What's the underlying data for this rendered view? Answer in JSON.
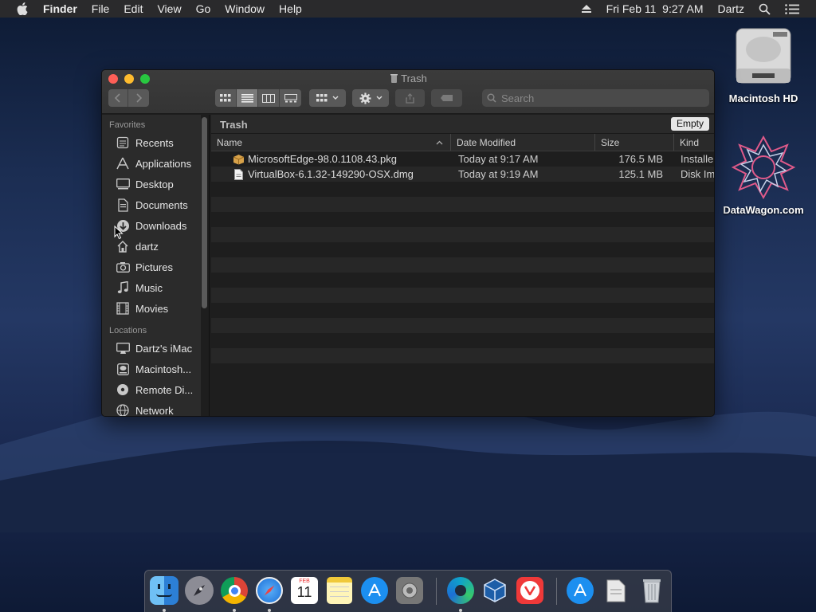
{
  "menubar": {
    "items": [
      {
        "label": "Finder",
        "bold": true
      },
      {
        "label": "File"
      },
      {
        "label": "Edit"
      },
      {
        "label": "View"
      },
      {
        "label": "Go"
      },
      {
        "label": "Window"
      },
      {
        "label": "Help"
      }
    ],
    "datetime": "Fri Feb 11  9:27 AM",
    "user": "Dartz"
  },
  "desktop": {
    "icons": [
      {
        "label": "Macintosh HD",
        "icon": "hard-drive-icon"
      },
      {
        "label": "DataWagon.com",
        "icon": "datawagon-logo-icon"
      }
    ]
  },
  "window": {
    "title": "Trash",
    "search_placeholder": "Search",
    "path_title": "Trash",
    "empty_label": "Empty",
    "sidebar": {
      "favorites_header": "Favorites",
      "favorites": [
        {
          "label": "Recents",
          "icon": "recents-icon"
        },
        {
          "label": "Applications",
          "icon": "applications-icon"
        },
        {
          "label": "Desktop",
          "icon": "desktop-icon"
        },
        {
          "label": "Documents",
          "icon": "documents-icon"
        },
        {
          "label": "Downloads",
          "icon": "downloads-icon"
        },
        {
          "label": "dartz",
          "icon": "home-icon"
        },
        {
          "label": "Pictures",
          "icon": "camera-icon"
        },
        {
          "label": "Music",
          "icon": "music-note-icon"
        },
        {
          "label": "Movies",
          "icon": "film-icon"
        }
      ],
      "locations_header": "Locations",
      "locations": [
        {
          "label": "Dartz's iMac",
          "icon": "imac-icon"
        },
        {
          "label": "Macintosh...",
          "icon": "disk-icon"
        },
        {
          "label": "Remote Di...",
          "icon": "remote-disc-icon"
        },
        {
          "label": "Network",
          "icon": "network-icon"
        }
      ]
    },
    "columns": [
      "Name",
      "Date Modified",
      "Size",
      "Kind"
    ],
    "files": [
      {
        "name": "MicrosoftEdge-98.0.1108.43.pkg",
        "modified": "Today at 9:17 AM",
        "size": "176.5 MB",
        "kind": "Installe...",
        "icon": "package-icon"
      },
      {
        "name": "VirtualBox-6.1.32-149290-OSX.dmg",
        "modified": "Today at 9:19 AM",
        "size": "125.1 MB",
        "kind": "Disk Ima",
        "icon": "document-icon"
      }
    ]
  },
  "dock": {
    "apps": [
      {
        "name": "finder-icon",
        "running": true
      },
      {
        "name": "launchpad-icon",
        "running": false
      },
      {
        "name": "chrome-icon",
        "running": true
      },
      {
        "name": "safari-icon",
        "running": true
      },
      {
        "name": "calendar-icon",
        "running": false,
        "month": "FEB",
        "day": "11"
      },
      {
        "name": "notes-icon",
        "running": false
      },
      {
        "name": "app-store-icon",
        "running": false
      },
      {
        "name": "system-preferences-icon",
        "running": false
      },
      {
        "name": "edge-icon",
        "running": true
      },
      {
        "name": "virtualbox-icon",
        "running": false
      },
      {
        "name": "vivaldi-icon",
        "running": false
      },
      {
        "name": "app-store-downloads-icon",
        "running": false
      },
      {
        "name": "document-stack-icon",
        "running": false
      },
      {
        "name": "trash-icon",
        "running": false
      }
    ]
  }
}
